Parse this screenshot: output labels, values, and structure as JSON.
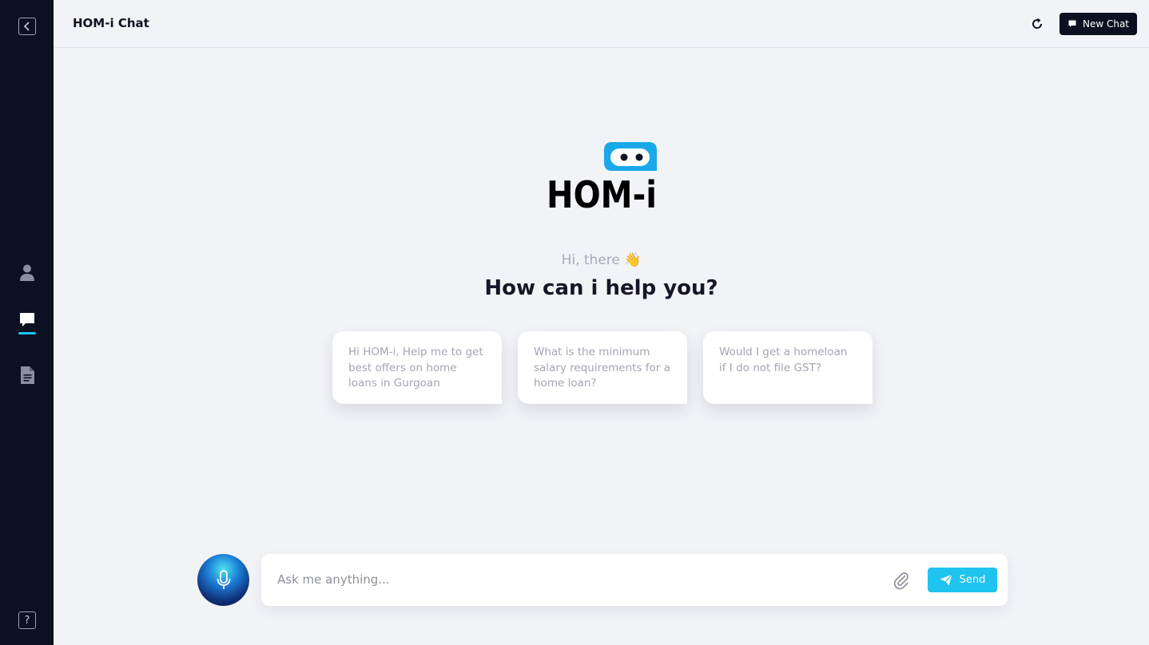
{
  "header": {
    "title": "HOM-i Chat",
    "new_chat_label": "New Chat"
  },
  "logo": {
    "text": "HOM-i"
  },
  "welcome": {
    "greeting": "Hi, there 👋",
    "headline": "How can i help you?"
  },
  "suggestions": [
    "Hi HOM-i, Help me to get best offers on home loans in Gurgoan",
    "What is the minimum salary requirements for a home loan?",
    "Would I get a homeloan if I do not file GST?"
  ],
  "composer": {
    "placeholder": "Ask me anything...",
    "value": "",
    "send_label": "Send"
  },
  "sidebar": {
    "help_label": "?",
    "items": [
      {
        "icon": "user-icon"
      },
      {
        "icon": "chat-icon",
        "active": true
      },
      {
        "icon": "document-icon"
      }
    ]
  },
  "colors": {
    "sidebar_bg": "#0d1021",
    "accent": "#1fc3ef",
    "page_bg": "#f2f3f7",
    "logo_bubble": "#1aa8e8"
  }
}
